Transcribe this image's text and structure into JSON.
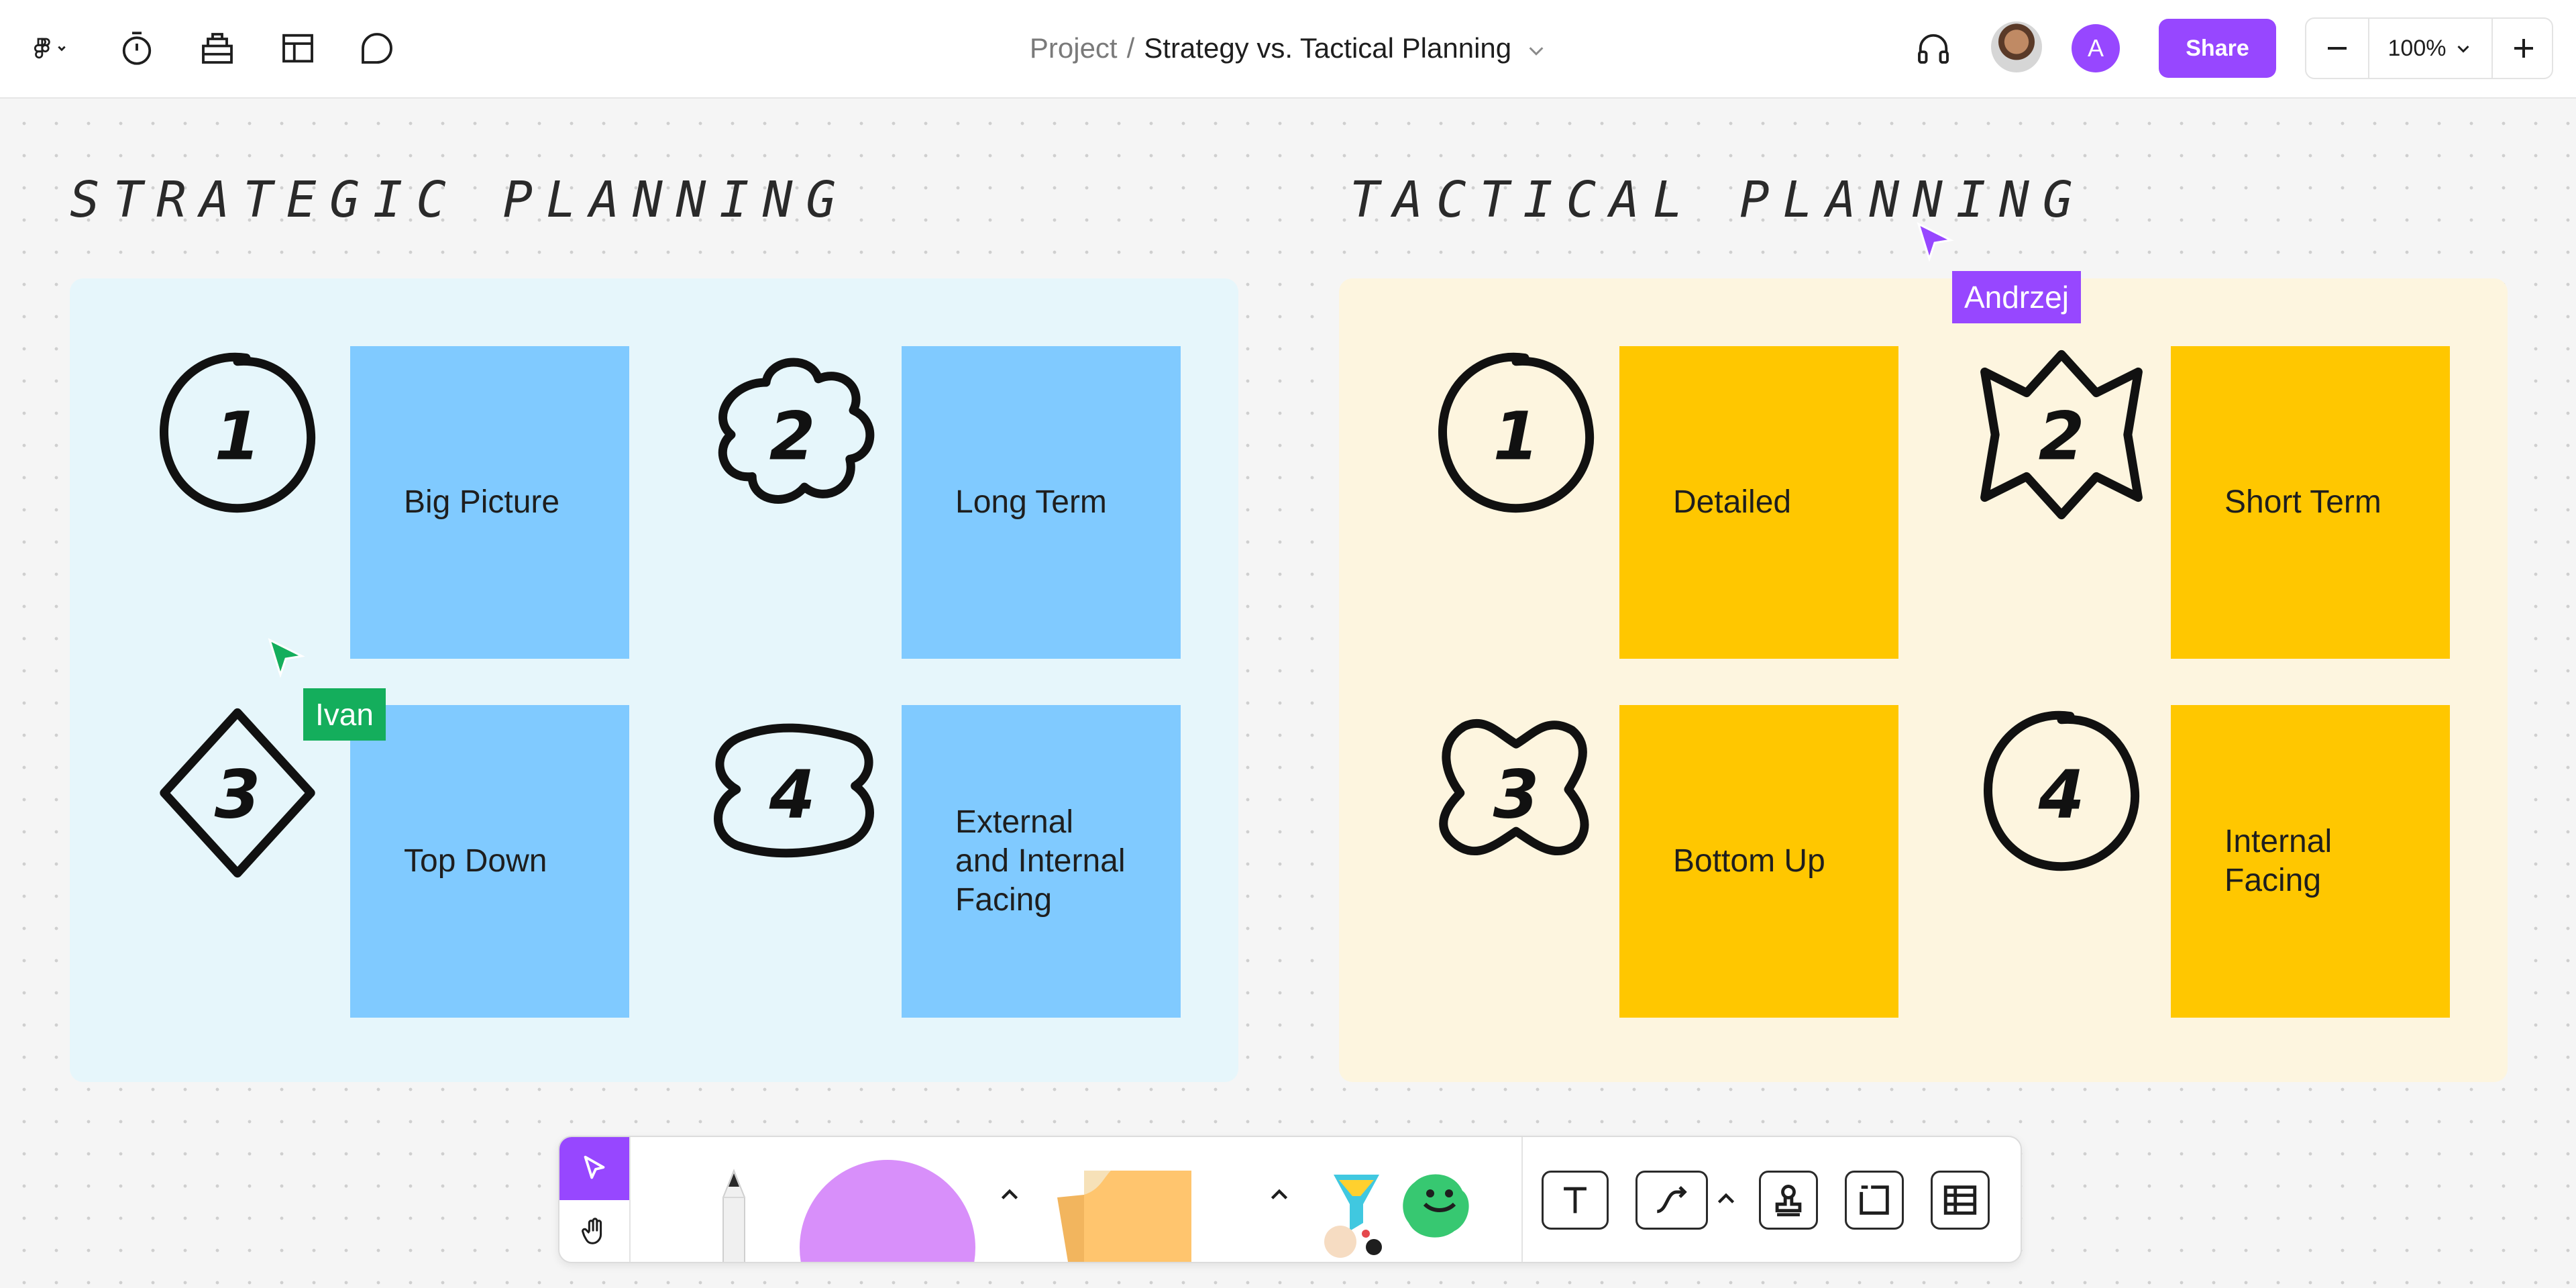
{
  "header": {
    "breadcrumb_project": "Project",
    "breadcrumb_separator": "/",
    "file_title": "Strategy vs. Tactical Planning",
    "share_label": "Share",
    "avatar_letter": "A",
    "zoom_level": "100%",
    "icons": [
      "figma-menu-icon",
      "timer-icon",
      "library-icon",
      "layout-icon",
      "comment-icon",
      "audio-chat-icon"
    ]
  },
  "canvas": {
    "strategic": {
      "title": "STRATEGIC PLANNING",
      "items": [
        {
          "number": "1",
          "text": "Big Picture"
        },
        {
          "number": "2",
          "text": "Long Term"
        },
        {
          "number": "3",
          "text": "Top Down"
        },
        {
          "number": "4",
          "text": "External and Internal Facing"
        }
      ],
      "panel_color": "#e6f6fb",
      "sticky_color": "#80caff"
    },
    "tactical": {
      "title": "TACTICAL PLANNING",
      "items": [
        {
          "number": "1",
          "text": "Detailed"
        },
        {
          "number": "2",
          "text": "Short Term"
        },
        {
          "number": "3",
          "text": "Bottom Up"
        },
        {
          "number": "4",
          "text": "Internal Facing"
        }
      ],
      "panel_color": "#fdf5df",
      "sticky_color": "#ffc700"
    },
    "collaborators": [
      {
        "name": "Ivan",
        "color": "#14ae5c"
      },
      {
        "name": "Andrzej",
        "color": "#9747ff"
      }
    ]
  },
  "toolbar": {
    "accent": "#9747ff",
    "tools": [
      "select-tool",
      "hand-tool",
      "marker-tool",
      "shape-tool",
      "sticky-note-tool",
      "stickers-tool",
      "text-tool",
      "connector-tool",
      "stamp-tool",
      "section-tool",
      "table-tool"
    ]
  }
}
